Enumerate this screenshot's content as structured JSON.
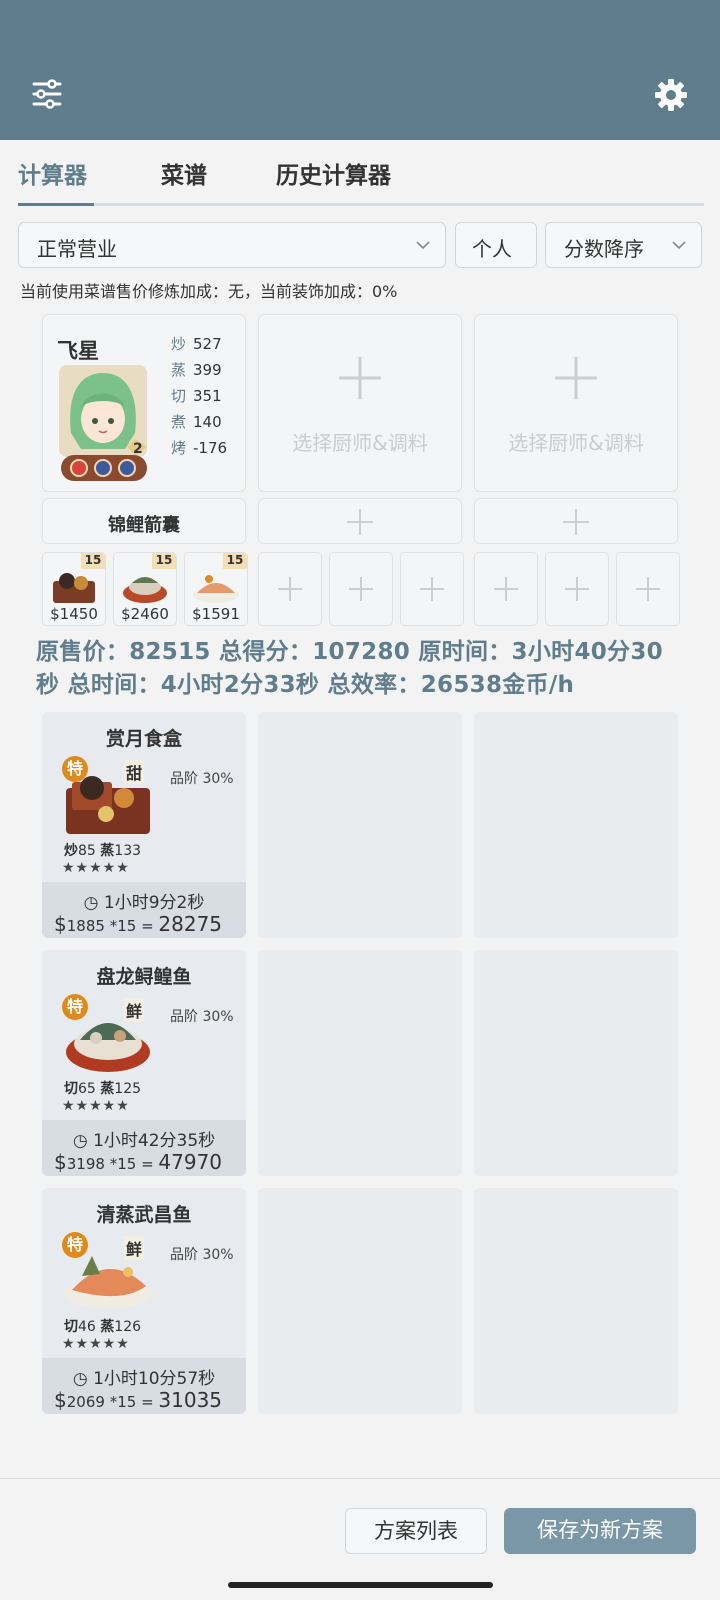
{
  "appbar": {
    "menu_icon": "sliders-icon",
    "settings_icon": "gear-icon",
    "color": "#5f7d8c"
  },
  "tabs": [
    {
      "label": "计算器",
      "active": true
    },
    {
      "label": "菜谱",
      "active": false
    },
    {
      "label": "历史计算器",
      "active": false
    }
  ],
  "filters": {
    "mode": "正常营业",
    "scope": "个人",
    "sort": "分数降序"
  },
  "info_line": "当前使用菜谱售价修炼加成：无，当前装饰加成：0%",
  "chef": {
    "name": "飞星",
    "level": "2",
    "stats": [
      {
        "k": "炒",
        "v": "527"
      },
      {
        "k": "蒸",
        "v": "399"
      },
      {
        "k": "切",
        "v": "351"
      },
      {
        "k": "煮",
        "v": "140"
      },
      {
        "k": "烤",
        "v": "-176"
      }
    ]
  },
  "empty_slot_label": "选择厨师&调料",
  "equip": {
    "label": "锦鲤箭囊"
  },
  "dishes_small": [
    {
      "count": "15",
      "price": "$1450"
    },
    {
      "count": "15",
      "price": "$2460"
    },
    {
      "count": "15",
      "price": "$1591"
    }
  ],
  "summary": "原售价：82515 总得分：107280 原时间：3小时40分30秒 总时间：4小时2分33秒 总效率：26538金币/h",
  "recipes": [
    {
      "name": "赏月食盒",
      "special": "特",
      "flavor": "甜",
      "grade": "品阶 30%",
      "skill1_k": "炒",
      "skill1_v": "85",
      "skill2_k": "蒸",
      "skill2_v": "133",
      "stars": "★★★★★",
      "time": "1小时9分2秒",
      "unit": "1885",
      "mult": "*15",
      "total": "28275"
    },
    {
      "name": "盘龙鲟鳇鱼",
      "special": "特",
      "flavor": "鲜",
      "grade": "品阶 30%",
      "skill1_k": "切",
      "skill1_v": "65",
      "skill2_k": "蒸",
      "skill2_v": "125",
      "stars": "★★★★★",
      "time": "1小时42分35秒",
      "unit": "3198",
      "mult": "*15",
      "total": "47970"
    },
    {
      "name": "清蒸武昌鱼",
      "special": "特",
      "flavor": "鲜",
      "grade": "品阶 30%",
      "skill1_k": "切",
      "skill1_v": "46",
      "skill2_k": "蒸",
      "skill2_v": "126",
      "stars": "★★★★★",
      "time": "1小时10分57秒",
      "unit": "2069",
      "mult": "*15",
      "total": "31035"
    }
  ],
  "buttons": {
    "list": "方案列表",
    "save": "保存为新方案"
  }
}
